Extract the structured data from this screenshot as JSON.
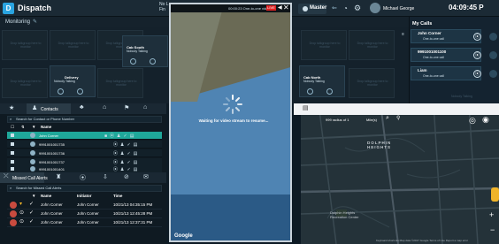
{
  "app": {
    "title": "Dispatch",
    "icon": "dispatch-app-icon"
  },
  "topbar": {
    "no_location": "No L\nFin",
    "master_label": "Master",
    "user_name": "Michael George",
    "time": "04:09:45 P"
  },
  "monitoring": {
    "label": "Monitoring",
    "placeholder_tile_text": "Drop talkgroup here to monitor",
    "tiles": [
      {
        "name": "Cab South",
        "sub": "Nobody Talking"
      },
      {
        "name": "Delivery",
        "sub": "Nobody Talking"
      },
      {
        "name": "Cab North",
        "sub": "Nobody Talking"
      }
    ]
  },
  "mycalls": {
    "title": "My Calls",
    "calls": [
      {
        "name": "John Corner",
        "type": "One-to-one call"
      },
      {
        "name": "9991001001100",
        "type": "One-to-one call"
      },
      {
        "name": "Liam",
        "type": "One-to-one call"
      }
    ],
    "footer": "Nobody Talking"
  },
  "contacts": {
    "tab_label": "Contacts",
    "search_placeholder": "Search for Contact or Phone Number",
    "column_name": "Name",
    "rows": [
      {
        "name": "John Corner",
        "selected": true
      },
      {
        "name": "9991001001735",
        "selected": false
      },
      {
        "name": "9991001001736",
        "selected": false
      },
      {
        "name": "9991001001737",
        "selected": false
      },
      {
        "name": "9991001001401",
        "selected": false
      }
    ]
  },
  "missed": {
    "tab_label": "Missed Call Alerts",
    "search_placeholder": "Search for Missed Call Alerts",
    "columns": {
      "name": "Name",
      "initiator": "Initiator",
      "time": "Time"
    },
    "rows": [
      {
        "name": "John Corner",
        "initiator": "John Corner",
        "time": "10/21/13 04:35:15 PM"
      },
      {
        "name": "John Corner",
        "initiator": "John Corner",
        "time": "10/21/13 12:45:28 PM"
      },
      {
        "name": "John Corner",
        "initiator": "John Corner",
        "time": "10/21/13 12:37:31 PM"
      }
    ]
  },
  "video": {
    "status": "00:00:23 One-to-one video",
    "live_badge": "LIVE",
    "waiting_text": "Waiting for video stream to resume...",
    "google_label": "Google"
  },
  "map": {
    "radius_label": "999 radius of 1",
    "unit_label": "Mile(s)",
    "area_label": "DOLPHIN\nHEIGHTS",
    "rec_center_label": "Dolphin Heights\nRecreation Center",
    "footer": "Keyboard shortcuts  Map data ©2017 Google  Terms of Use  Report a map error"
  },
  "colors": {
    "selected_row": "#1fa89a",
    "live_badge": "#dd2222",
    "accent": "#2aa4e0"
  }
}
